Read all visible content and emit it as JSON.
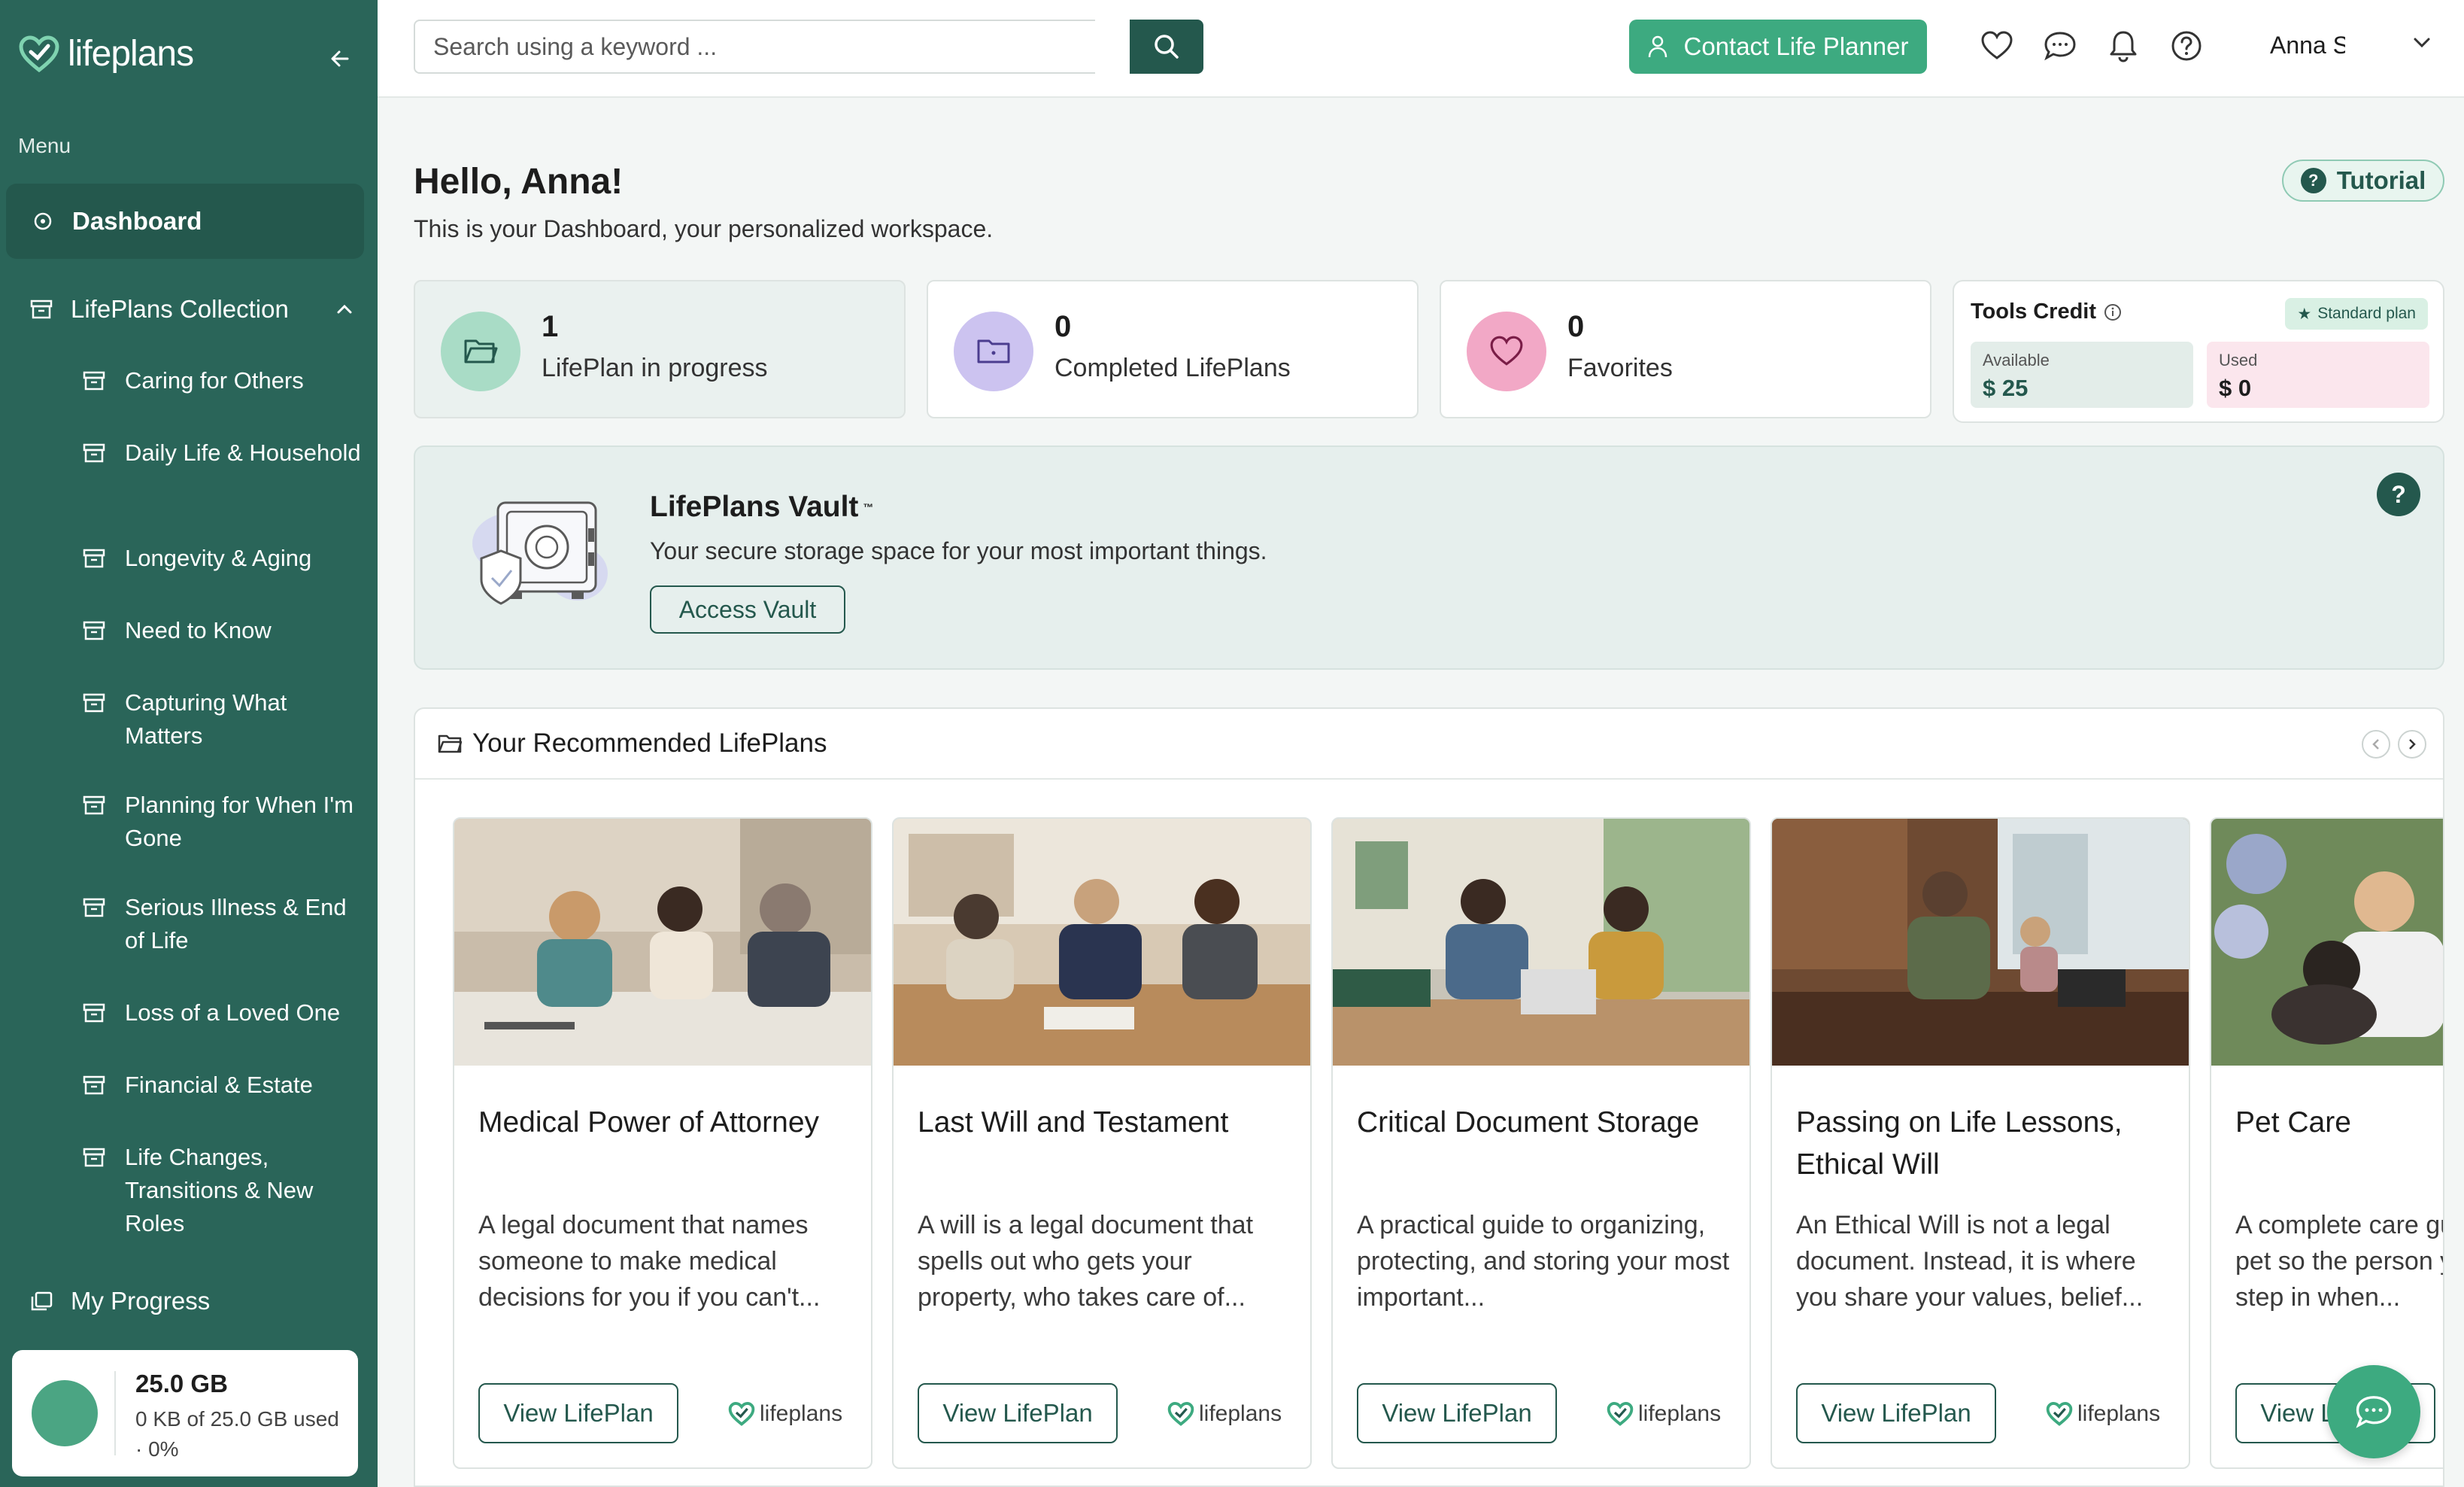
{
  "app": {
    "brand": "lifeplans",
    "accent": "#2a6559",
    "accent_light": "#3daa80"
  },
  "sidebar": {
    "menu_label": "Menu",
    "dashboard": "Dashboard",
    "collection": "LifePlans Collection",
    "items": [
      "Caring for Others",
      "Daily Life & Household",
      "Longevity & Aging",
      "Need to Know",
      "Capturing What Matters",
      "Planning for When I'm Gone",
      "Serious Illness & End of Life",
      "Loss of a Loved One",
      "Financial & Estate",
      "Life Changes, Transitions & New Roles"
    ],
    "progress": "My Progress",
    "storage": {
      "total": "25.0 GB",
      "usage": "0 KB of 25.0 GB used · 0%"
    }
  },
  "topbar": {
    "search_placeholder": "Search using a keyword ...",
    "contact": "Contact Life Planner",
    "user": "Anna S"
  },
  "main": {
    "greeting": "Hello, Anna!",
    "subtitle": "This is your Dashboard, your personalized workspace.",
    "tutorial": "Tutorial",
    "stats": [
      {
        "value": "1",
        "label": "LifePlan in progress"
      },
      {
        "value": "0",
        "label": "Completed LifePlans"
      },
      {
        "value": "0",
        "label": "Favorites"
      }
    ],
    "credit": {
      "title": "Tools Credit",
      "plan": "Standard plan",
      "available_label": "Available",
      "available": "$ 25",
      "used_label": "Used",
      "used": "$ 0"
    },
    "vault": {
      "title": "LifePlans Vault",
      "tm": "™",
      "subtitle": "Your secure storage space for your most important things.",
      "button": "Access Vault",
      "help": "?"
    },
    "recommended": {
      "title": "Your Recommended LifePlans",
      "button": "View LifePlan",
      "cards": [
        {
          "title": "Medical Power of Attorney",
          "desc": "A legal document that names someone to make medical decisions for you if you can't..."
        },
        {
          "title": "Last Will and Testament",
          "desc": "A will is a legal document that spells out who gets your property, who takes care of..."
        },
        {
          "title": "Critical Document Storage",
          "desc": "A practical guide to organizing, protecting, and storing your most important..."
        },
        {
          "title": "Passing on Life Lessons, Ethical Will",
          "desc": "An Ethical Will is not a legal document. Instead, it is where you share your values, belief..."
        },
        {
          "title": "Pet Care",
          "desc": "A complete care guide for your pet so the person you trust can step in when..."
        }
      ]
    }
  }
}
